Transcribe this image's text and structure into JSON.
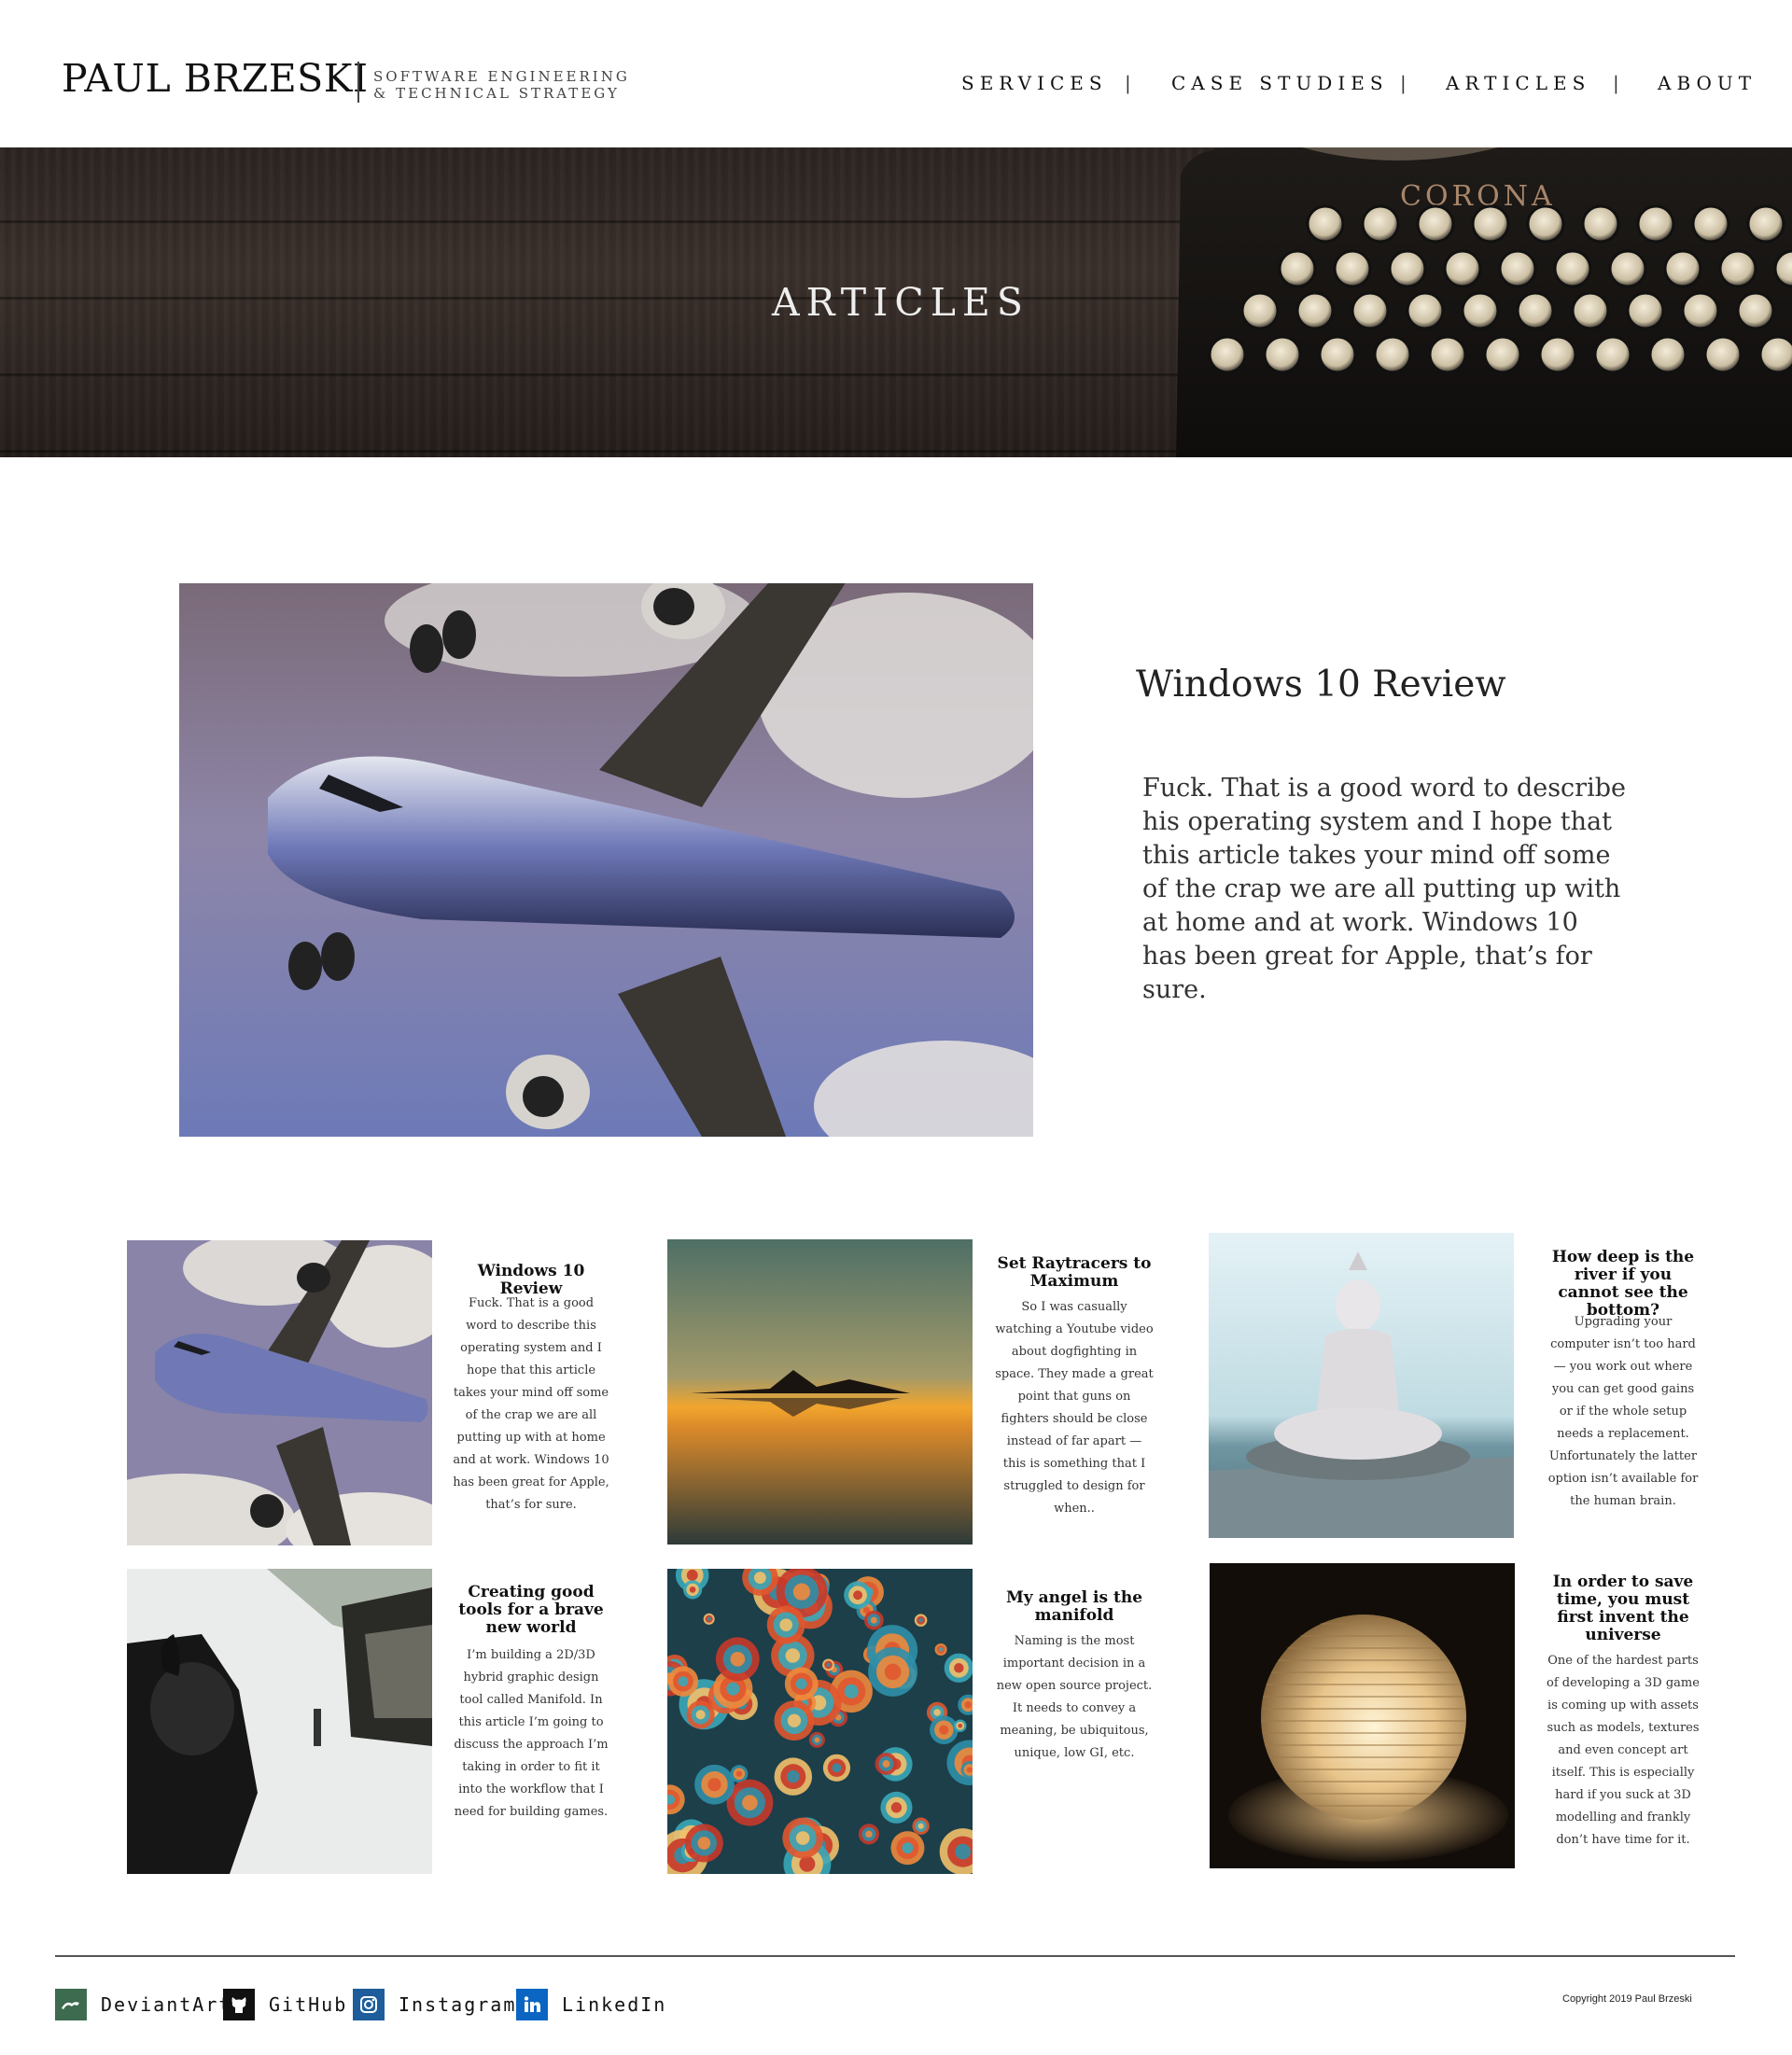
{
  "header": {
    "brand": "PAUL BRZESKI",
    "tagline_line1": "SOFTWARE ENGINEERING",
    "tagline_line2": "& TECHNICAL STRATEGY",
    "nav": [
      "SERVICES",
      "CASE STUDIES",
      "ARTICLES",
      "ABOUT"
    ],
    "nav_separator": "|"
  },
  "hero": {
    "title": "ARTICLES"
  },
  "featured": {
    "title": "Windows 10 Review",
    "text": "Fuck. That is a good word to describe his operating system and I hope that this article takes your mind off some of the crap we are all putting up with at home and at work. Windows 10 has been great for Apple, that’s for sure."
  },
  "articles": [
    {
      "title": "Windows 10 Review",
      "excerpt": "Fuck. That is a good word to describe this operating system and I hope that this article takes your mind off some of the crap we are all putting up with at home and at work. Windows 10 has been great for Apple, that’s for sure.",
      "image": "airplane"
    },
    {
      "title": "Set Raytracers to Maximum",
      "excerpt": "So I was casually watching a Youtube video about dogfighting in space. They made a great point that guns on fighters should be close instead of far apart — this is something that I struggled to design for when..",
      "image": "sunset-island"
    },
    {
      "title": "How deep is the river if you cannot see the bottom?",
      "excerpt": "Upgrading your computer isn’t too hard — you work out where you can get good gains or if the whole setup needs a replacement. Unfortunately the latter option isn’t available for the human brain.",
      "image": "shiva-statue"
    },
    {
      "title": "Creating good tools for a brave new world",
      "excerpt": "I’m building a 2D/3D hybrid graphic design tool called Manifold. In this article I’m going to discuss the approach I’m taking in order to fit it into the workflow that I need for building games.",
      "image": "village-warrior"
    },
    {
      "title": "My angel is the manifold",
      "excerpt": "Naming is the most important decision in a new open source project. It needs to convey a meaning, be ubiquitous, unique, low GI, etc.",
      "image": "fractal"
    },
    {
      "title": "In order to save time, you must first invent the universe",
      "excerpt": "One of the hardest parts of developing a 3D game is coming up with assets such as models, textures and even concept art itself. This is especially hard if you suck at 3D modelling and frankly don’t have time for it.",
      "image": "paper-lantern"
    }
  ],
  "hero_typewriter_brand": "CORONA",
  "footer": {
    "social": [
      {
        "label": "DeviantArt",
        "icon": "deviantart-icon",
        "color": "#3d6b4f"
      },
      {
        "label": "GitHub",
        "icon": "github-icon",
        "color": "#111111"
      },
      {
        "label": "Instagram",
        "icon": "instagram-icon",
        "color": "#1d5d9b"
      },
      {
        "label": "LinkedIn",
        "icon": "linkedin-icon",
        "color": "#0a66c2"
      }
    ],
    "copyright": "Copyright 2019 Paul Brzeski"
  }
}
